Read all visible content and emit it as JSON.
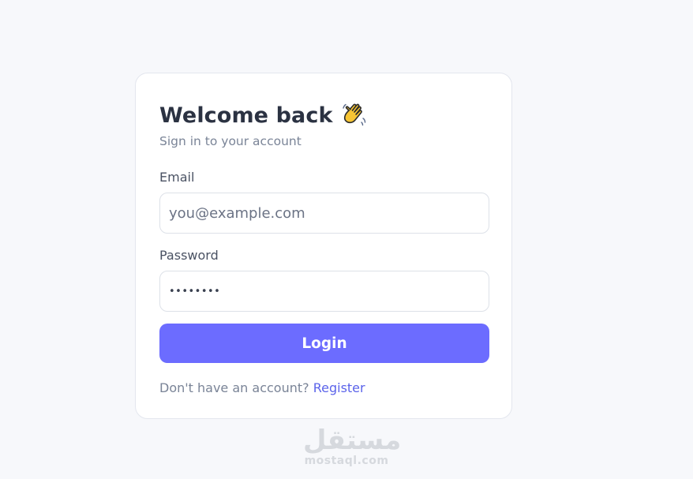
{
  "login": {
    "title": "Welcome back",
    "title_emoji_icon": "waving-hand-icon",
    "subtitle": "Sign in to your account",
    "email_label": "Email",
    "email_placeholder": "you@example.com",
    "password_label": "Password",
    "password_value": "••••••••",
    "login_button": "Login",
    "register_prompt": "Don't have an account?",
    "register_link": "Register"
  },
  "watermark": {
    "arabic": "مستقل",
    "domain": "mostaql.com"
  },
  "colors": {
    "background": "#f7f8fb",
    "card": "#ffffff",
    "accent": "#6c6cff",
    "link": "#5b63ea",
    "title": "#2b3242",
    "muted": "#7a8497"
  }
}
